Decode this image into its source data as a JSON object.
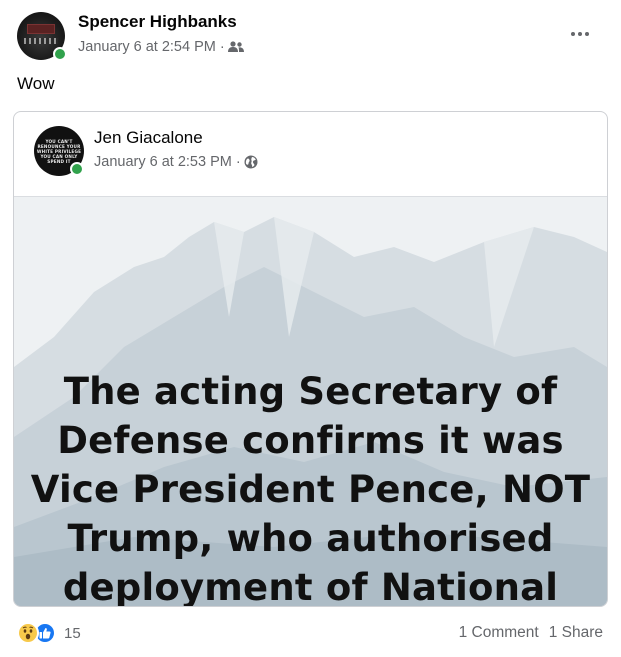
{
  "post": {
    "author": "Spencer Highbanks",
    "timestamp": "January 6 at 2:54 PM",
    "separator": "·",
    "audience_icon": "friends-icon",
    "text": "Wow"
  },
  "shared_post": {
    "author": "Jen Giacalone",
    "timestamp": "January 6 at 2:53 PM",
    "separator": "·",
    "audience_icon": "globe-icon",
    "avatar_text": "YOU CAN'T RENOUNCE YOUR WHITE PRIVILEGE YOU CAN ONLY SPEND IT",
    "image_headline": "The acting Secretary of Defense confirms it was Vice President Pence, NOT Trump, who authorised deployment of National Guard"
  },
  "footer": {
    "reaction_icons": [
      "wow-icon",
      "like-icon"
    ],
    "reaction_count": "15",
    "comments": "1 Comment",
    "shares": "1 Share"
  },
  "colors": {
    "secondary_text": "#65676b",
    "online": "#31a24c",
    "like_blue": "#1877f2",
    "wow_yellow": "#f7c94b"
  }
}
